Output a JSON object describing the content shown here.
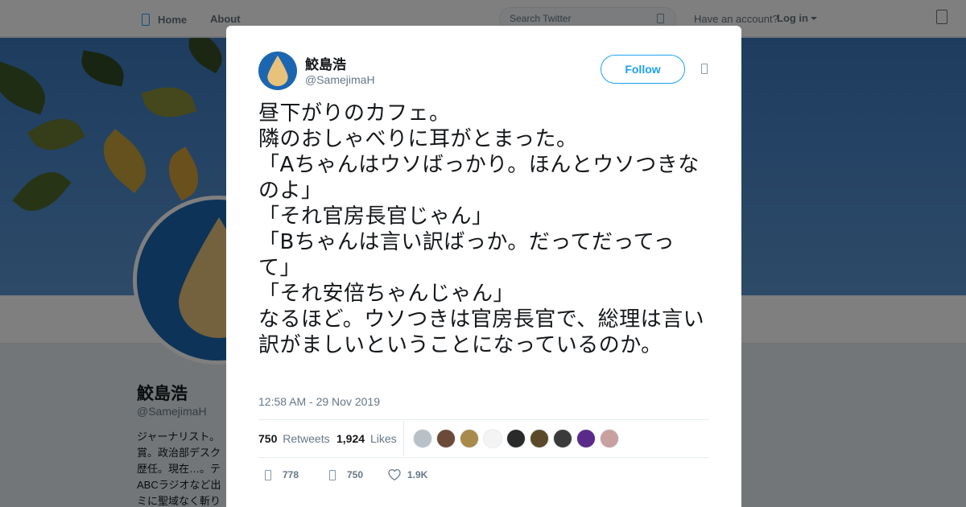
{
  "topbar": {
    "home_label": "Home",
    "about_label": "About",
    "search_placeholder": "Search Twitter",
    "have_account_text": "Have an account?",
    "login_label": "Log in"
  },
  "profile": {
    "name": "鮫島浩",
    "handle": "@SamejimaH",
    "bio_lines": [
      "ジャーナリスト。",
      "賞。政治部デスク",
      "歴任。現在…。テ",
      "ABCラジオなど出",
      "ミに聖域なく斬り"
    ]
  },
  "tweet": {
    "author_name": "鮫島浩",
    "author_handle": "@SamejimaH",
    "follow_label": "Follow",
    "text": "昼下がりのカフェ。\n隣のおしゃべりに耳がとまった。\n「Aちゃんはウソばっかり。ほんとウソつきなのよ」\n「それ官房長官じゃん」\n「Bちゃんは言い訳ばっか。だってだってって」\n「それ安倍ちゃんじゃん」\nなるほど。ウソつきは官房長官で、総理は言い訳がましいということになっているのか。",
    "timestamp": "12:58 AM - 29 Nov 2019",
    "retweets_count": "750",
    "retweets_label": "Retweets",
    "likes_count": "1,924",
    "likes_label": "Likes",
    "actions": {
      "reply_count": "778",
      "retweet_count": "750",
      "like_count": "1.9K"
    }
  },
  "colors": {
    "accent": "#1da1f2",
    "avatar_bg": "#1b66b1",
    "drop": "#e8c27a"
  },
  "icons": [
    "home-icon",
    "search-icon",
    "compose-icon",
    "more-icon",
    "reply-icon",
    "retweet-icon",
    "heart-icon"
  ]
}
